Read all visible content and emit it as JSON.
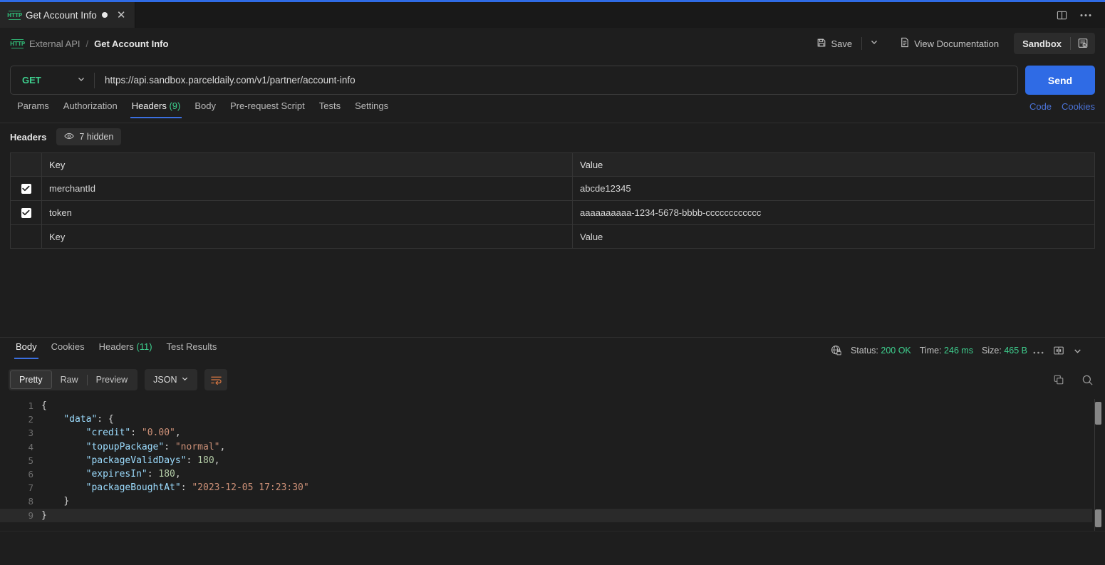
{
  "window": {
    "layout_icon": "panel-layout-icon",
    "more_icon": "ellipsis-icon"
  },
  "tab": {
    "icon": "http-request-icon",
    "title": "Get Account Info",
    "unsaved_dot": "unsaved-indicator",
    "close_icon": "close-icon"
  },
  "breadcrumb": {
    "icon": "http-request-icon",
    "collection": "External API",
    "separator": "/",
    "current": "Get Account Info"
  },
  "toolbar": {
    "save_label": "Save",
    "save_icon": "save-disk-icon",
    "save_chevron": "chevron-down-icon",
    "docs_label": "View Documentation",
    "docs_icon": "document-icon",
    "environment": "Sandbox",
    "env_icon": "environment-quick-look-icon"
  },
  "request": {
    "method": "GET",
    "method_chevron": "chevron-down-icon",
    "url": "https://api.sandbox.parceldaily.com/v1/partner/account-info",
    "send_label": "Send"
  },
  "request_tabs": {
    "items": [
      {
        "label": "Params",
        "count": "",
        "active": false
      },
      {
        "label": "Authorization",
        "count": "",
        "active": false
      },
      {
        "label": "Headers",
        "count": "(9)",
        "active": true
      },
      {
        "label": "Body",
        "count": "",
        "active": false
      },
      {
        "label": "Pre-request Script",
        "count": "",
        "active": false
      },
      {
        "label": "Tests",
        "count": "",
        "active": false
      },
      {
        "label": "Settings",
        "count": "",
        "active": false
      }
    ],
    "code_link": "Code",
    "cookies_link": "Cookies"
  },
  "headers_section": {
    "title": "Headers",
    "hidden_pill": "7 hidden",
    "hidden_icon": "eye-icon",
    "columns": [
      "Key",
      "Value"
    ],
    "rows": [
      {
        "checked": true,
        "key": "merchantId",
        "value": "abcde12345"
      },
      {
        "checked": true,
        "key": "token",
        "value": "aaaaaaaaaa-1234-5678-bbbb-cccccccccccc"
      }
    ],
    "placeholder_row": {
      "key": "Key",
      "value": "Value"
    }
  },
  "response_tabs": {
    "items": [
      {
        "label": "Body",
        "count": "",
        "active": true
      },
      {
        "label": "Cookies",
        "count": "",
        "active": false
      },
      {
        "label": "Headers",
        "count": "(11)",
        "active": false
      },
      {
        "label": "Test Results",
        "count": "",
        "active": false
      }
    ]
  },
  "response_status": {
    "shield_icon": "globe-lock-icon",
    "status_label": "Status:",
    "status_value": "200 OK",
    "time_label": "Time:",
    "time_value": "246 ms",
    "size_label": "Size:",
    "size_value": "465 B",
    "more_icon": "ellipsis-icon",
    "expand_icon": "split-pane-icon",
    "collapse_icon": "chevron-down-icon"
  },
  "body_toolbar": {
    "views": [
      "Pretty",
      "Raw",
      "Preview"
    ],
    "active_view": "Pretty",
    "format": "JSON",
    "format_chevron": "chevron-down-icon",
    "wrap_icon": "wrap-lines-icon",
    "copy_icon": "copy-icon",
    "search_icon": "search-icon"
  },
  "response_body": {
    "language": "json",
    "lines": [
      {
        "n": "1",
        "indent": 0,
        "tokens": [
          {
            "t": "punc",
            "v": "{"
          }
        ]
      },
      {
        "n": "2",
        "indent": 1,
        "tokens": [
          {
            "t": "key",
            "v": "\"data\""
          },
          {
            "t": "punc",
            "v": ": {"
          }
        ]
      },
      {
        "n": "3",
        "indent": 2,
        "tokens": [
          {
            "t": "key",
            "v": "\"credit\""
          },
          {
            "t": "punc",
            "v": ": "
          },
          {
            "t": "str",
            "v": "\"0.00\""
          },
          {
            "t": "punc",
            "v": ","
          }
        ]
      },
      {
        "n": "4",
        "indent": 2,
        "tokens": [
          {
            "t": "key",
            "v": "\"topupPackage\""
          },
          {
            "t": "punc",
            "v": ": "
          },
          {
            "t": "str",
            "v": "\"normal\""
          },
          {
            "t": "punc",
            "v": ","
          }
        ]
      },
      {
        "n": "5",
        "indent": 2,
        "tokens": [
          {
            "t": "key",
            "v": "\"packageValidDays\""
          },
          {
            "t": "punc",
            "v": ": "
          },
          {
            "t": "num",
            "v": "180"
          },
          {
            "t": "punc",
            "v": ","
          }
        ]
      },
      {
        "n": "6",
        "indent": 2,
        "tokens": [
          {
            "t": "key",
            "v": "\"expiresIn\""
          },
          {
            "t": "punc",
            "v": ": "
          },
          {
            "t": "num",
            "v": "180"
          },
          {
            "t": "punc",
            "v": ","
          }
        ]
      },
      {
        "n": "7",
        "indent": 2,
        "tokens": [
          {
            "t": "key",
            "v": "\"packageBoughtAt\""
          },
          {
            "t": "punc",
            "v": ": "
          },
          {
            "t": "str",
            "v": "\"2023-12-05 17:23:30\""
          }
        ]
      },
      {
        "n": "8",
        "indent": 1,
        "tokens": [
          {
            "t": "punc",
            "v": "}"
          }
        ]
      },
      {
        "n": "9",
        "indent": 0,
        "tokens": [
          {
            "t": "punc",
            "v": "}"
          }
        ]
      }
    ]
  },
  "colors": {
    "accent_blue": "#2f6be5",
    "method_green": "#3ecf8e",
    "link_blue": "#4a72d6",
    "wrap_orange": "#d97742",
    "bg": "#1e1e1e"
  }
}
